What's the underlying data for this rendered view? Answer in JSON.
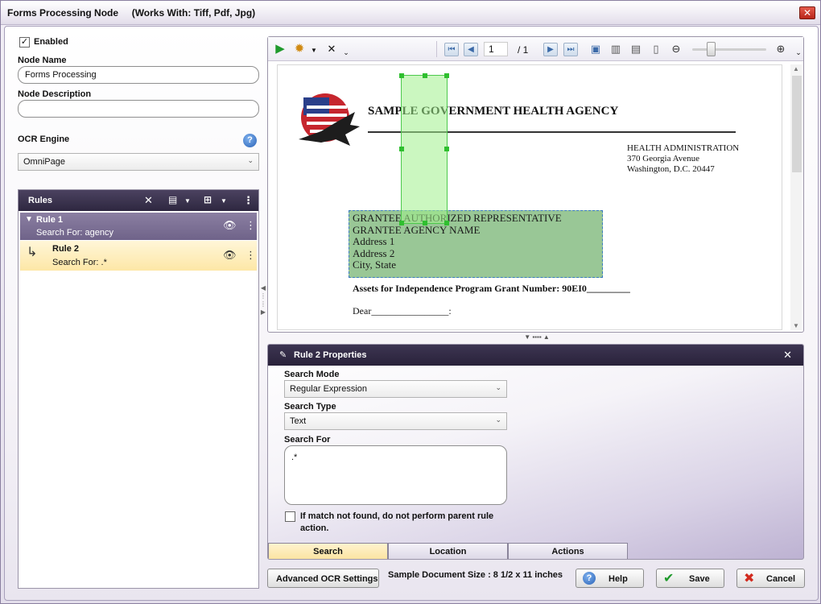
{
  "window": {
    "title": "Forms Processing Node     (Works With: Tiff, Pdf, Jpg)",
    "close_glyph": "✕"
  },
  "left": {
    "enabled_label": "Enabled",
    "enabled_checked": true,
    "node_name_label": "Node Name",
    "node_name_value": "Forms Processing",
    "node_description_label": "Node Description",
    "node_description_value": "",
    "ocr_engine_label": "OCR Engine",
    "ocr_engine_value": "OmniPage"
  },
  "rules": {
    "header": "Rules",
    "items": [
      {
        "name": "Rule 1",
        "search": "Search For: agency"
      },
      {
        "name": "Rule 2",
        "search": "Search For: .*"
      }
    ]
  },
  "viewer": {
    "page_current": "1",
    "page_total": "/ 1",
    "doc": {
      "agency": "SAMPLE GOVERNMENT HEALTH AGENCY",
      "dept": "HEALTH ADMINISTRATION",
      "street": "370 Georgia Avenue",
      "city": "Washington, D.C. 20447",
      "addr_lines": [
        "GRANTEE AUTHORIZED REPRESENTATIVE",
        "GRANTEE AGENCY NAME",
        "Address 1",
        "Address 2",
        "City, State"
      ],
      "grant_line": "Assets for Independence Program Grant Number:  90EI0_________",
      "dear_line": "Dear________________:"
    }
  },
  "properties": {
    "title": "Rule 2 Properties",
    "search_mode_label": "Search Mode",
    "search_mode_value": "Regular Expression",
    "search_type_label": "Search Type",
    "search_type_value": "Text",
    "search_for_label": "Search For",
    "search_for_value": ".*",
    "no_match_label": "If match not found, do not perform parent rule action.",
    "tabs": [
      "Search",
      "Location",
      "Actions"
    ]
  },
  "footer": {
    "advanced_ocr": "Advanced OCR Settings",
    "sample_size": "Sample Document Size : 8 1/2 x 11 inches",
    "help": "Help",
    "save": "Save",
    "cancel": "Cancel"
  },
  "colors": {
    "accent_header": "#2e2740",
    "selected_rule": "#fde7a6",
    "highlight_green": "#7ec27a"
  }
}
